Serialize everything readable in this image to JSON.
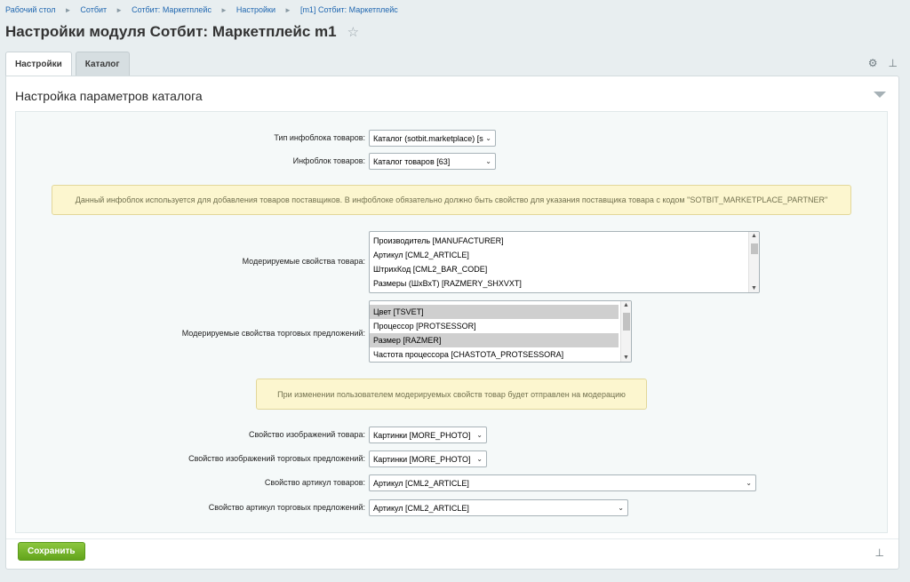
{
  "breadcrumbs": [
    "Рабочий стол",
    "Сотбит",
    "Сотбит: Маркетплейс",
    "Настройки",
    "[m1] Сотбит: Маркетплейс"
  ],
  "breadcrumb_sep": "►",
  "page_title": "Настройки модуля Сотбит: Маркетплейс m1",
  "tabs": [
    {
      "label": "Настройки",
      "active": true
    },
    {
      "label": "Каталог",
      "active": false
    }
  ],
  "section_title": "Настройка параметров каталога",
  "fields": {
    "iblock_type": {
      "label": "Тип инфоблока товаров:",
      "value": "Каталог (sotbit.marketplace) [s"
    },
    "iblock": {
      "label": "Инфоблок товаров:",
      "value": "Каталог товаров [63]"
    },
    "notice1": "Данный инфоблок используется для добавления товаров поставщиков. В инфоблоке обязательно должно быть свойство для указания поставщика товара с кодом \"SOTBIT_MARKETPLACE_PARTNER\"",
    "moderated_props": {
      "label": "Модерируемые свойства товара:",
      "options": [
        {
          "text": "Производитель [MANUFACTURER]",
          "selected": false
        },
        {
          "text": "Артикул [CML2_ARTICLE]",
          "selected": false
        },
        {
          "text": "ШтрихКод [CML2_BAR_CODE]",
          "selected": false
        },
        {
          "text": "Размеры (ШхВхТ) [RAZMERY_SHXVXT]",
          "selected": false
        }
      ]
    },
    "moderated_offer_props": {
      "label": "Модерируемые свойства торговых предложений:",
      "options": [
        {
          "text": "Цвет [TSVET]",
          "selected": true
        },
        {
          "text": "Процессор [PROTSESSOR]",
          "selected": false
        },
        {
          "text": "Размер [RAZMER]",
          "selected": true
        },
        {
          "text": "Частота процессора [CHASTOTA_PROTSESSORA]",
          "selected": false
        }
      ]
    },
    "notice2": "При изменении пользователем модерируемых свойств товар будет отправлен на модерацию",
    "image_prop": {
      "label": "Свойство изображений товара:",
      "value": "Картинки [MORE_PHOTO]"
    },
    "offer_image_prop": {
      "label": "Свойство изображений торговых предложений:",
      "value": "Картинки [MORE_PHOTO]"
    },
    "article_prop": {
      "label": "Свойство артикул товаров:",
      "value": "Артикул [CML2_ARTICLE]"
    },
    "offer_article_prop": {
      "label": "Свойство артикул торговых предложений:",
      "value": "Артикул [CML2_ARTICLE]"
    }
  },
  "save_label": "Сохранить"
}
